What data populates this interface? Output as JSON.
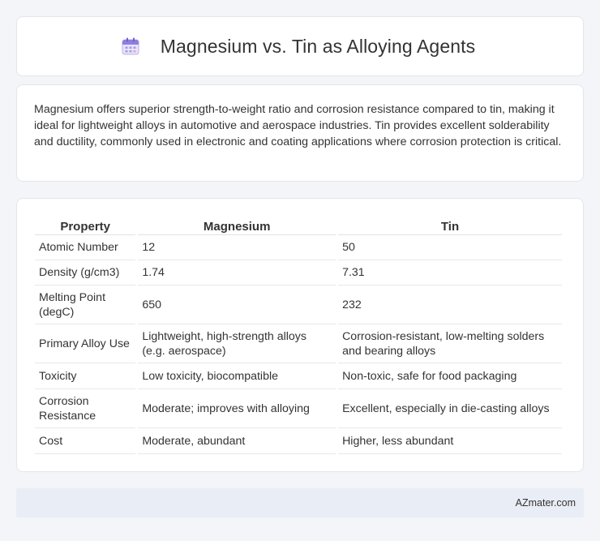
{
  "header": {
    "icon": "calendar-icon",
    "title": "Magnesium vs. Tin as Alloying Agents"
  },
  "description": "Magnesium offers superior strength-to-weight ratio and corrosion resistance compared to tin, making it ideal for lightweight alloys in automotive and aerospace industries. Tin provides excellent solderability and ductility, commonly used in electronic and coating applications where corrosion protection is critical.",
  "table": {
    "headers": [
      "Property",
      "Magnesium",
      "Tin"
    ],
    "rows": [
      [
        "Atomic Number",
        "12",
        "50"
      ],
      [
        "Density (g/cm3)",
        "1.74",
        "7.31"
      ],
      [
        "Melting Point (degC)",
        "650",
        "232"
      ],
      [
        "Primary Alloy Use",
        "Lightweight, high-strength alloys (e.g. aerospace)",
        "Corrosion-resistant, low-melting solders and bearing alloys"
      ],
      [
        "Toxicity",
        "Low toxicity, biocompatible",
        "Non-toxic, safe for food packaging"
      ],
      [
        "Corrosion Resistance",
        "Moderate; improves with alloying",
        "Excellent, especially in die-casting alloys"
      ],
      [
        "Cost",
        "Moderate, abundant",
        "Higher, less abundant"
      ]
    ]
  },
  "footer": {
    "brand": "AZmater.com"
  }
}
